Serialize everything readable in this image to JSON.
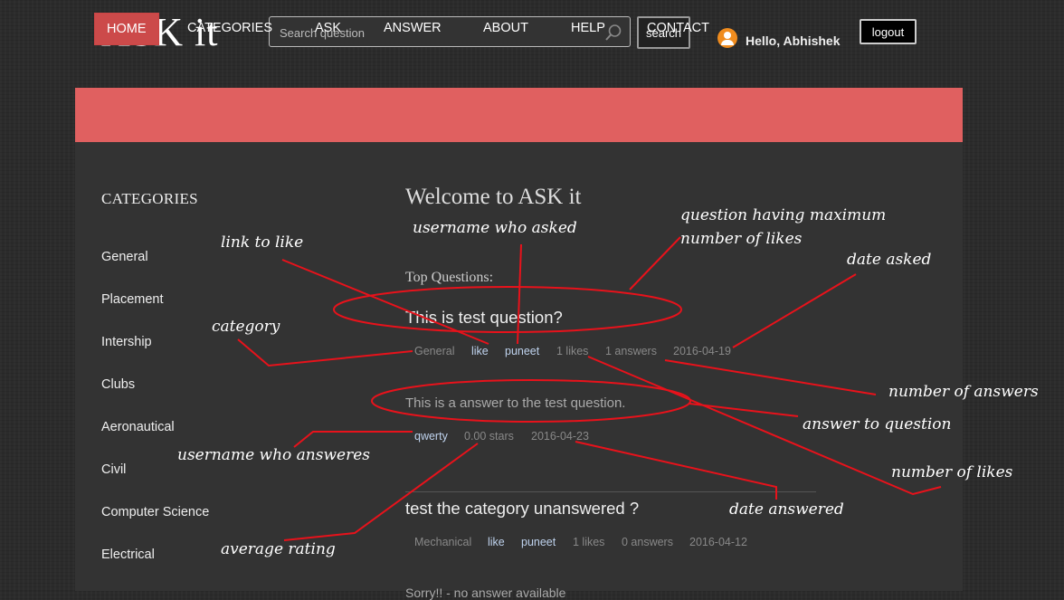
{
  "header": {
    "logo": "ASK it",
    "search_placeholder": "Search question",
    "search_button": "search",
    "greeting": "Hello, Abhishek",
    "logout_button": "logout"
  },
  "nav": {
    "items": [
      "HOME",
      "CATEGORIES",
      "ASK",
      "ANSWER",
      "ABOUT",
      "HELP",
      "CONTACT"
    ],
    "active": "HOME"
  },
  "sidebar": {
    "title": "CATEGORIES",
    "items": [
      "General",
      "Placement",
      "Intership",
      "Clubs",
      "Aeronautical",
      "Civil",
      "Computer Science",
      "Electrical"
    ]
  },
  "main": {
    "welcome": "Welcome to ASK it",
    "top_label": "Top Questions:",
    "questions": [
      {
        "title": "This is test question?",
        "category": "General",
        "like_link": "like",
        "user": "puneet",
        "likes": "1 likes",
        "answers": "1 answers",
        "date": "2016-04-19",
        "answer": {
          "text": "This is a answer to the test question.",
          "user": "qwerty",
          "rating": "0.00 stars",
          "date": "2016-04-23"
        }
      },
      {
        "title": "test the category unanswered ?",
        "category": "Mechanical",
        "like_link": "like",
        "user": "puneet",
        "likes": "1 likes",
        "answers": "0 answers",
        "date": "2016-04-12",
        "note": "Sorry!! - no answer available"
      }
    ]
  },
  "annotations": {
    "link_to_like": "link to like",
    "username_who_asked": "username who asked",
    "question_max_likes_line1": "question having maximum",
    "question_max_likes_line2": "number of likes",
    "date_asked": "date asked",
    "category": "category",
    "number_of_answers": "number of answers",
    "answer_to_question": "answer to question",
    "username_who_answers": "username who answeres",
    "number_of_likes": "number of likes",
    "date_answered": "date answered",
    "average_rating": "average rating",
    "color": "#e8121b"
  }
}
